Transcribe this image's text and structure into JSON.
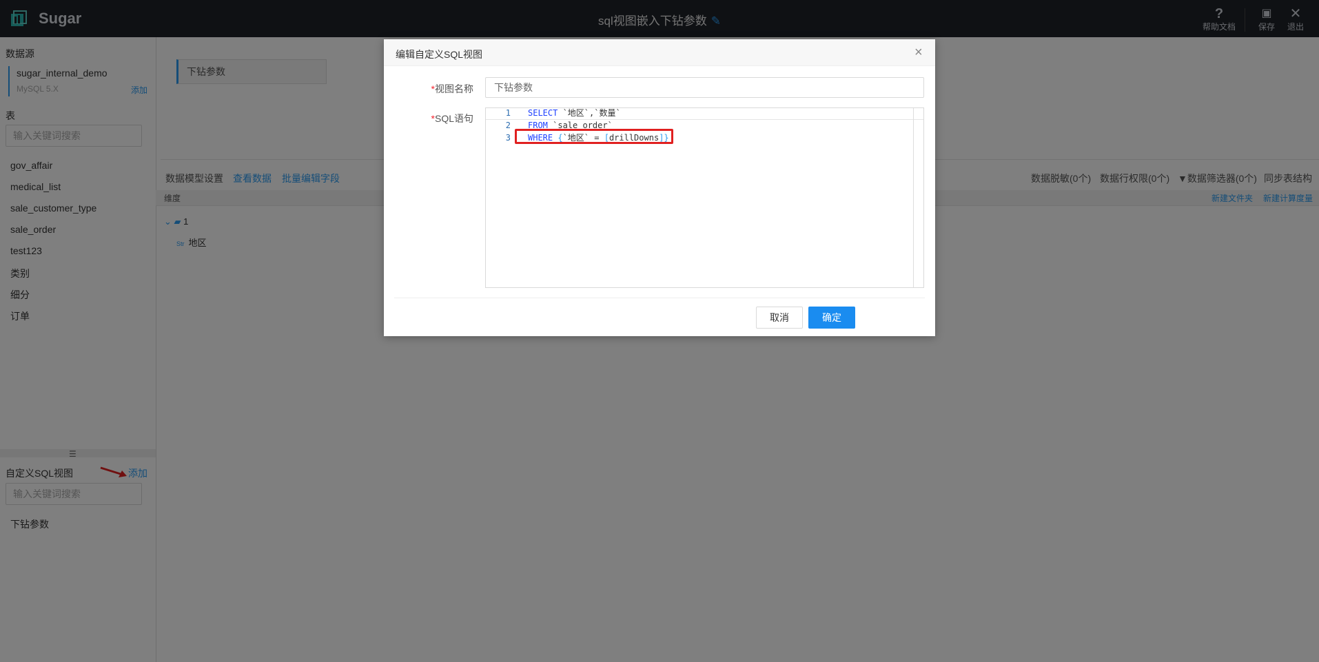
{
  "app": {
    "brand": "Sugar",
    "doc_title": "sql视图嵌入下钻参数",
    "edit_icon": "edit-icon",
    "buttons": {
      "help": {
        "label": "帮助文档",
        "icon": "?"
      },
      "save": {
        "label": "保存",
        "icon": "▣"
      },
      "exit": {
        "label": "退出",
        "icon": "✕"
      }
    }
  },
  "sidebar": {
    "datasource_header": "数据源",
    "datasource_name": "sugar_internal_demo",
    "datasource_type": "MySQL 5.X",
    "datasource_add": "添加",
    "tables_header": "表",
    "tables_search_placeholder": "输入关键词搜索",
    "tables": [
      "gov_affair",
      "medical_list",
      "sale_customer_type",
      "sale_order",
      "test123",
      "类别",
      "细分",
      "订单"
    ],
    "sqlview_header": "自定义SQL视图",
    "sqlview_add": "添加",
    "sqlview_search_placeholder": "输入关键词搜索",
    "sqlviews": [
      "下钻参数"
    ]
  },
  "main": {
    "view_tab": "下钻参数",
    "toolbar_left": [
      "数据模型设置",
      "查看数据",
      "批量编辑字段"
    ],
    "toolbar_right": [
      "数据脱敏(0个)",
      "数据行权限(0个)",
      "数据筛选器(0个)",
      "同步表结构"
    ],
    "dims_header": "维度",
    "header_links": [
      "新建文件夹",
      "新建计算度量"
    ],
    "folder": "1",
    "field": {
      "type": "Str",
      "name": "地区"
    }
  },
  "modal": {
    "title": "编辑自定义SQL视图",
    "close": "×",
    "name_label": "视图名称",
    "name_value": "下钻参数",
    "sql_label": "SQL语句",
    "code": [
      {
        "n": "1",
        "kw": "SELECT",
        "rest": " `地区`,`数量`"
      },
      {
        "n": "2",
        "kw": "FROM",
        "rest": " `sale_order`"
      },
      {
        "n": "3",
        "kw": "WHERE",
        "open": " {",
        "rest": "`地区` = ",
        "brk_open": "[",
        "param": "drillDowns",
        "brk_close": "]}"
      }
    ],
    "cancel": "取消",
    "ok": "确定"
  }
}
